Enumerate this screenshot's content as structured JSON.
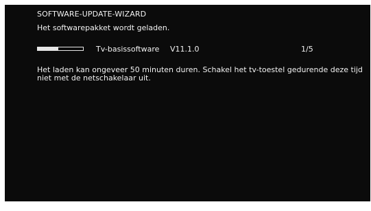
{
  "wizard": {
    "title": "SOFTWARE-UPDATE-WIZARD",
    "subtitle": "Het softwarepakket wordt geladen."
  },
  "progress": {
    "package_name": "Tv-basissoftware",
    "version": "V11.1.0",
    "step": "1/5",
    "fraction": 0.45
  },
  "message": "Het laden kan ongeveer 50 minuten duren. Schakel het tv-toestel gedurende deze tijd niet met de netschakelaar uit.",
  "colors": {
    "screen_background": "#0b0b0b",
    "text": "#f2f2f2",
    "progress": "#e6e6e6"
  }
}
